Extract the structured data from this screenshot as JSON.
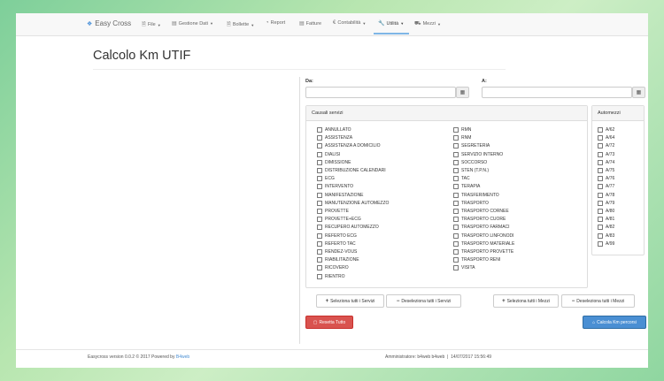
{
  "navbar": {
    "brand": "Easy Cross",
    "items": [
      {
        "label": "File",
        "icon": "file-icon",
        "dropdown": true
      },
      {
        "label": "Gestione Dati",
        "icon": "database-icon",
        "dropdown": true
      },
      {
        "label": "Bollette",
        "icon": "document-icon",
        "dropdown": true
      },
      {
        "label": "Report",
        "icon": "pie-chart-icon",
        "dropdown": false
      },
      {
        "label": "Fatture",
        "icon": "ledger-icon",
        "dropdown": false
      },
      {
        "label": "Contabilità",
        "icon": "euro-icon",
        "dropdown": true
      },
      {
        "label": "Utilità",
        "icon": "wrench-icon",
        "dropdown": true,
        "active": true
      },
      {
        "label": "Mezzi",
        "icon": "truck-icon",
        "dropdown": true
      }
    ]
  },
  "page": {
    "title": "Calcolo Km UTIF"
  },
  "dates": {
    "from_label": "Da:",
    "from_value": "",
    "to_label": "A:",
    "to_value": ""
  },
  "servizi": {
    "title": "Causali servizi",
    "col1": [
      "ANNULLATO",
      "ASSISTENZA",
      "ASSISTENZA A DOMICILIO",
      "DIALISI",
      "DIMISSIONE",
      "DISTRIBUZIONE CALENDARI",
      "ECG",
      "INTERVENTO",
      "MANIFESTAZIONE",
      "MANUTENZIONE AUTOMEZZO",
      "PROVETTE",
      "PROVETTE+ECG",
      "RECUPERO AUTOMEZZO",
      "REFERTO ECG",
      "REFERTO TAC",
      "RENDEZ-VOUS",
      "RIABILITAZIONE",
      "RICOVERO",
      "RIENTRO"
    ],
    "col2": [
      "RMN",
      "RNM",
      "SEGRETERIA",
      "SERVIZIO INTERNO",
      "SOCCORSO",
      "STEN (T.P.N.)",
      "TAC",
      "TERAPIA",
      "TRASFERIMENTO",
      "TRASPORTO",
      "TRASPORTO CORNEE",
      "TRASPORTO CUORE",
      "TRASPORTO FARMACI",
      "TRASPORTO LINFONODI",
      "TRASPORTO MATERIALE",
      "TRASPORTO PROVETTE",
      "TRASPORTO RENI",
      "VISITA"
    ]
  },
  "mezzi": {
    "title": "Automezzi",
    "items": [
      "A/62",
      "A/64",
      "A/72",
      "A/73",
      "A/74",
      "A/75",
      "A/76",
      "A/77",
      "A/78",
      "A/79",
      "A/80",
      "A/81",
      "A/82",
      "A/83",
      "A/99"
    ]
  },
  "buttons": {
    "select_all_servizi": "Seleziona tutti i Servizi",
    "deselect_all_servizi": "Deseleziona tutti i Servizi",
    "select_all_mezzi": "Seleziona tutti i Mezzi",
    "deselect_all_mezzi": "Deseleziona tutti i Mezzi",
    "reset": "Resetta Tutto",
    "calc": "Calcola Km percorsi"
  },
  "footer": {
    "version_text": "Easycross version 0.0.2 © 2017 Powered by",
    "link": "B4web",
    "admin": "Amministratore: b4web b4web",
    "datetime": "14/07/2017 15:56:49"
  },
  "colors": {
    "accent": "#4a8fd3",
    "danger": "#d9534f",
    "nav_active_underline": "#7fb6e6"
  }
}
